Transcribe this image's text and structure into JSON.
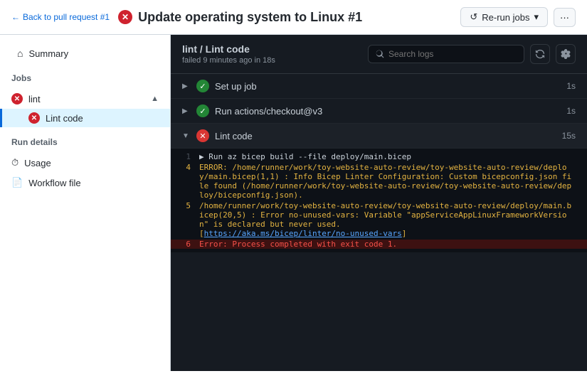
{
  "topbar": {
    "back_label": "Back to pull request #1",
    "title": "Update operating system to Linux #1",
    "rerun_label": "Re-run jobs",
    "more_label": "···"
  },
  "sidebar": {
    "summary_label": "Summary",
    "jobs_label": "Jobs",
    "job_name": "lint",
    "sub_job_name": "Lint code",
    "run_details_label": "Run details",
    "usage_label": "Usage",
    "workflow_file_label": "Workflow file"
  },
  "main": {
    "title": "lint / Lint code",
    "subtitle": "failed 9 minutes ago in 18s",
    "search_placeholder": "Search logs",
    "steps": [
      {
        "name": "Set up job",
        "time": "1s",
        "status": "success",
        "expanded": false
      },
      {
        "name": "Run actions/checkout@v3",
        "time": "1s",
        "status": "success",
        "expanded": false
      },
      {
        "name": "Lint code",
        "time": "15s",
        "status": "error",
        "expanded": true
      }
    ],
    "log_lines": [
      {
        "num": "1",
        "content": "▶ Run az bicep build --file deploy/main.bicep",
        "type": "normal"
      },
      {
        "num": "4",
        "content": "ERROR: /home/runner/work/toy-website-auto-review/toy-website-auto-review/deploy/main.bicep(1,1) : Info Bicep Linter Configuration: Custom bicepconfig.json file found (/home/runner/work/toy-website-auto-review/toy-website-auto-review/deploy/bicepconfig.json).",
        "type": "warning"
      },
      {
        "num": "5",
        "content": "/home/runner/work/toy-website-auto-review/toy-website-auto-review/deploy/main.bicep(20,5) : Error no-unused-vars: Variable \"appServiceAppLinuxFrameworkVersion\" is declared but never used.\n[https://aka.ms/bicep/linter/no-unused-vars]",
        "type": "warning"
      },
      {
        "num": "6",
        "content": "Error: Process completed with exit code 1.",
        "type": "error"
      }
    ]
  }
}
